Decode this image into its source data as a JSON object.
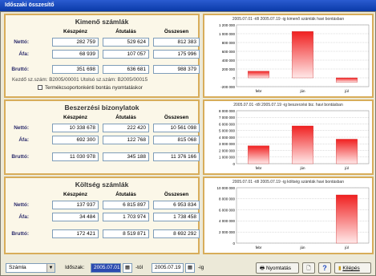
{
  "window_title": "Időszaki összesítő",
  "panels": [
    {
      "title": "Kimenő számlák",
      "headers": [
        "Készpénz",
        "Átutalás",
        "Összesen"
      ],
      "rows": [
        {
          "label": "Nettó:",
          "values": [
            "282 759",
            "529 624",
            "812 383"
          ]
        },
        {
          "label": "Áfa:",
          "values": [
            "68 939",
            "107 057",
            "175 996"
          ]
        },
        {
          "label": "Bruttó:",
          "values": [
            "351 698",
            "636 681",
            "988 379"
          ]
        }
      ],
      "range_text": "Kezdő sz.szám: B2005/00001    Utolsó sz.szám: B2005/00015",
      "checkbox_label": "Termékcsoportonkénti bontás nyomtatáskor"
    },
    {
      "title": "Beszerzési bizonylatok",
      "headers": [
        "Készpénz",
        "Átutalás",
        "Összesen"
      ],
      "rows": [
        {
          "label": "Nettó:",
          "values": [
            "10 338 678",
            "222 420",
            "10 561 098"
          ]
        },
        {
          "label": "Áfa:",
          "values": [
            "692 300",
            "122 768",
            "815 068"
          ]
        },
        {
          "label": "Bruttó:",
          "values": [
            "11 030 978",
            "345 188",
            "11 376 166"
          ]
        }
      ]
    },
    {
      "title": "Költség számlák",
      "headers": [
        "Készpénz",
        "Átutalás",
        "Összesen"
      ],
      "rows": [
        {
          "label": "Nettó:",
          "values": [
            "137 937",
            "6 815 897",
            "6 953 834"
          ]
        },
        {
          "label": "Áfa:",
          "values": [
            "34 484",
            "1 703 974",
            "1 738 458"
          ]
        },
        {
          "label": "Bruttó:",
          "values": [
            "172 421",
            "8 519 871",
            "8 692 292"
          ]
        }
      ]
    }
  ],
  "chart_data": [
    {
      "type": "bar",
      "title": "2005.07.01 -től 2005.07.19 -ig  kimenő számlák havi bontásban",
      "categories": [
        "febr",
        "jún",
        "júl"
      ],
      "values": [
        150000,
        1050000,
        -100000
      ],
      "ylim": [
        -200000,
        1200000
      ],
      "yticks": [
        "1 200 000",
        "1 000 000",
        "800 000",
        "600 000",
        "400 000",
        "200 000",
        "0",
        "-200 000"
      ],
      "grid": true
    },
    {
      "type": "bar",
      "title": "2005.07.01 -től 2005.07.19 -ig  beszerzési biz. havi bontásban",
      "categories": [
        "febr",
        "jún",
        "júl"
      ],
      "values": [
        2700000,
        5700000,
        3700000
      ],
      "ylim": [
        0,
        8000000
      ],
      "yticks": [
        "8 000 000",
        "7 000 000",
        "6 000 000",
        "5 000 000",
        "4 000 000",
        "3 000 000",
        "2 000 000",
        "1 000 000",
        "0"
      ],
      "grid": true
    },
    {
      "type": "bar",
      "title": "2005.07.01 -től 2005.07.19 -ig  költség számlák havi bontásban",
      "categories": [
        "febr",
        "jún",
        "júl"
      ],
      "values": [
        0,
        0,
        8700000
      ],
      "ylim": [
        0,
        10000000
      ],
      "yticks": [
        "10 000 000",
        "8 000 000",
        "6 000 000",
        "4 000 000",
        "2 000 000",
        "0"
      ],
      "grid": true
    }
  ],
  "bottom": {
    "type_select": "Számla",
    "period_label": "Időszak:",
    "date_from": "2005.07.01",
    "from_label": "-tól",
    "date_to": "2005.07.19",
    "to_label": "-ig",
    "print_label": "Nyomtatás",
    "help_label": "?",
    "exit_label": "Kilépés"
  },
  "colors": {
    "bar": "#f02020",
    "panel_border": "#d8ad5a"
  }
}
